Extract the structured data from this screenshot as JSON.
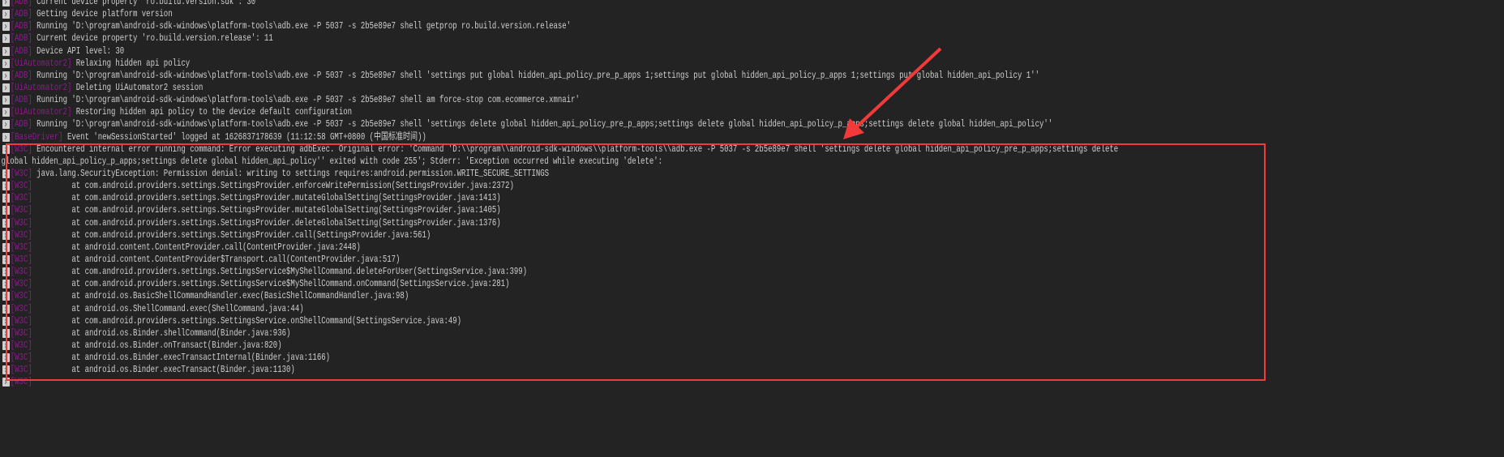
{
  "accent": {
    "tag_color": "#8e1a8e",
    "highlight_color": "#f23a3a",
    "background": "#232323",
    "text": "#d0d0d0"
  },
  "lines": [
    {
      "tag": "[ADB]",
      "text": " Current device property 'ro.build.version.sdk': 30"
    },
    {
      "tag": "[ADB]",
      "text": " Getting device platform version"
    },
    {
      "tag": "[ADB]",
      "text": " Running 'D:\\program\\android-sdk-windows\\platform-tools\\adb.exe -P 5037 -s 2b5e89e7 shell getprop ro.build.version.release'"
    },
    {
      "tag": "[ADB]",
      "text": " Current device property 'ro.build.version.release': 11"
    },
    {
      "tag": "[ADB]",
      "text": " Device API level: 30"
    },
    {
      "tag": "[UiAutomator2]",
      "text": " Relaxing hidden api policy"
    },
    {
      "tag": "[ADB]",
      "text": " Running 'D:\\program\\android-sdk-windows\\platform-tools\\adb.exe -P 5037 -s 2b5e89e7 shell 'settings put global hidden_api_policy_pre_p_apps 1;settings put global hidden_api_policy_p_apps 1;settings put global hidden_api_policy 1''"
    },
    {
      "tag": "[UiAutomator2]",
      "text": " Deleting UiAutomator2 session"
    },
    {
      "tag": "[ADB]",
      "text": " Running 'D:\\program\\android-sdk-windows\\platform-tools\\adb.exe -P 5037 -s 2b5e89e7 shell am force-stop com.ecommerce.xmnair'"
    },
    {
      "tag": "[UiAutomator2]",
      "text": " Restoring hidden api policy to the device default configuration"
    },
    {
      "tag": "[ADB]",
      "text": " Running 'D:\\program\\android-sdk-windows\\platform-tools\\adb.exe -P 5037 -s 2b5e89e7 shell 'settings delete global hidden_api_policy_pre_p_apps;settings delete global hidden_api_policy_p_apps;settings delete global hidden_api_policy''"
    },
    {
      "tag": "[BaseDriver]",
      "text": " Event 'newSessionStarted' logged at 1626837178639 (11:12:58 GMT+0800 (中国标准时间))"
    },
    {
      "tag": "[W3C]",
      "text": " Encountered internal error running command: Error executing adbExec. Original error: 'Command 'D:\\\\program\\\\android-sdk-windows\\\\platform-tools\\\\adb.exe -P 5037 -s 2b5e89e7 shell 'settings delete global hidden_api_policy_pre_p_apps;settings delete"
    },
    {
      "tag": "",
      "text": "global hidden_api_policy_p_apps;settings delete global hidden_api_policy'' exited with code 255'; Stderr: 'Exception occurred while executing 'delete':"
    },
    {
      "tag": "[W3C]",
      "text": " java.lang.SecurityException: Permission denial: writing to settings requires:android.permission.WRITE_SECURE_SETTINGS"
    },
    {
      "tag": "[W3C]",
      "text": "         at com.android.providers.settings.SettingsProvider.enforceWritePermission(SettingsProvider.java:2372)"
    },
    {
      "tag": "[W3C]",
      "text": "         at com.android.providers.settings.SettingsProvider.mutateGlobalSetting(SettingsProvider.java:1413)"
    },
    {
      "tag": "[W3C]",
      "text": "         at com.android.providers.settings.SettingsProvider.mutateGlobalSetting(SettingsProvider.java:1405)"
    },
    {
      "tag": "[W3C]",
      "text": "         at com.android.providers.settings.SettingsProvider.deleteGlobalSetting(SettingsProvider.java:1376)"
    },
    {
      "tag": "[W3C]",
      "text": "         at com.android.providers.settings.SettingsProvider.call(SettingsProvider.java:561)"
    },
    {
      "tag": "[W3C]",
      "text": "         at android.content.ContentProvider.call(ContentProvider.java:2448)"
    },
    {
      "tag": "[W3C]",
      "text": "         at android.content.ContentProvider$Transport.call(ContentProvider.java:517)"
    },
    {
      "tag": "[W3C]",
      "text": "         at com.android.providers.settings.SettingsService$MyShellCommand.deleteForUser(SettingsService.java:399)"
    },
    {
      "tag": "[W3C]",
      "text": "         at com.android.providers.settings.SettingsService$MyShellCommand.onCommand(SettingsService.java:281)"
    },
    {
      "tag": "[W3C]",
      "text": "         at android.os.BasicShellCommandHandler.exec(BasicShellCommandHandler.java:98)"
    },
    {
      "tag": "[W3C]",
      "text": "         at android.os.ShellCommand.exec(ShellCommand.java:44)"
    },
    {
      "tag": "[W3C]",
      "text": "         at com.android.providers.settings.SettingsService.onShellCommand(SettingsService.java:49)"
    },
    {
      "tag": "[W3C]",
      "text": "         at android.os.Binder.shellCommand(Binder.java:936)"
    },
    {
      "tag": "[W3C]",
      "text": "         at android.os.Binder.onTransact(Binder.java:820)"
    },
    {
      "tag": "[W3C]",
      "text": "         at android.os.Binder.execTransactInternal(Binder.java:1166)"
    },
    {
      "tag": "[W3C]",
      "text": "         at android.os.Binder.execTransact(Binder.java:1130)"
    },
    {
      "tag": "[W3C]",
      "text": ""
    }
  ]
}
